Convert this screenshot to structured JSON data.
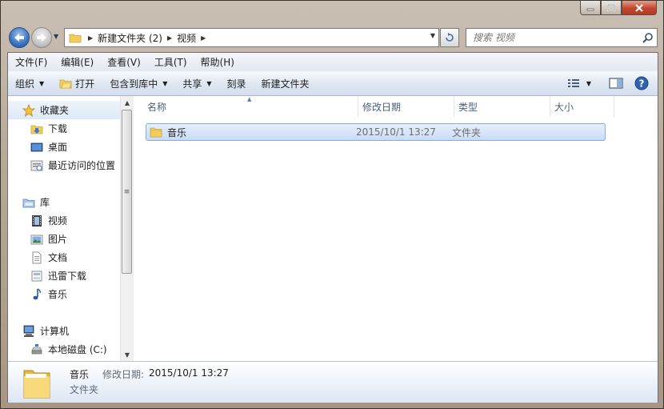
{
  "addressbar": {
    "segments": [
      "新建文件夹 (2)",
      "视频"
    ],
    "search_placeholder": "搜索 视频"
  },
  "menubar": {
    "items": [
      "文件(F)",
      "编辑(E)",
      "查看(V)",
      "工具(T)",
      "帮助(H)"
    ]
  },
  "toolbar": {
    "organize": "组织",
    "open": "打开",
    "include_library": "包含到库中",
    "share": "共享",
    "burn": "刻录",
    "new_folder": "新建文件夹"
  },
  "navpane": {
    "favorites": {
      "label": "收藏夹",
      "items": [
        "下载",
        "桌面",
        "最近访问的位置"
      ]
    },
    "libraries": {
      "label": "库",
      "items": [
        "视频",
        "图片",
        "文档",
        "迅雷下载",
        "音乐"
      ]
    },
    "computer": {
      "label": "计算机",
      "items": [
        "本地磁盘 (C:)"
      ]
    }
  },
  "content": {
    "columns": [
      "名称",
      "修改日期",
      "类型",
      "大小"
    ],
    "files": [
      {
        "name": "音乐",
        "modified": "2015/10/1 13:27",
        "type": "文件夹",
        "size": ""
      }
    ]
  },
  "details": {
    "name": "音乐",
    "modified_label": "修改日期:",
    "modified_value": "2015/10/1 13:27",
    "type": "文件夹"
  },
  "colors": {
    "selection": "#cce0f7",
    "toolbar_bg": "#dde5f1",
    "folder_yellow": "#f3cd5b"
  }
}
